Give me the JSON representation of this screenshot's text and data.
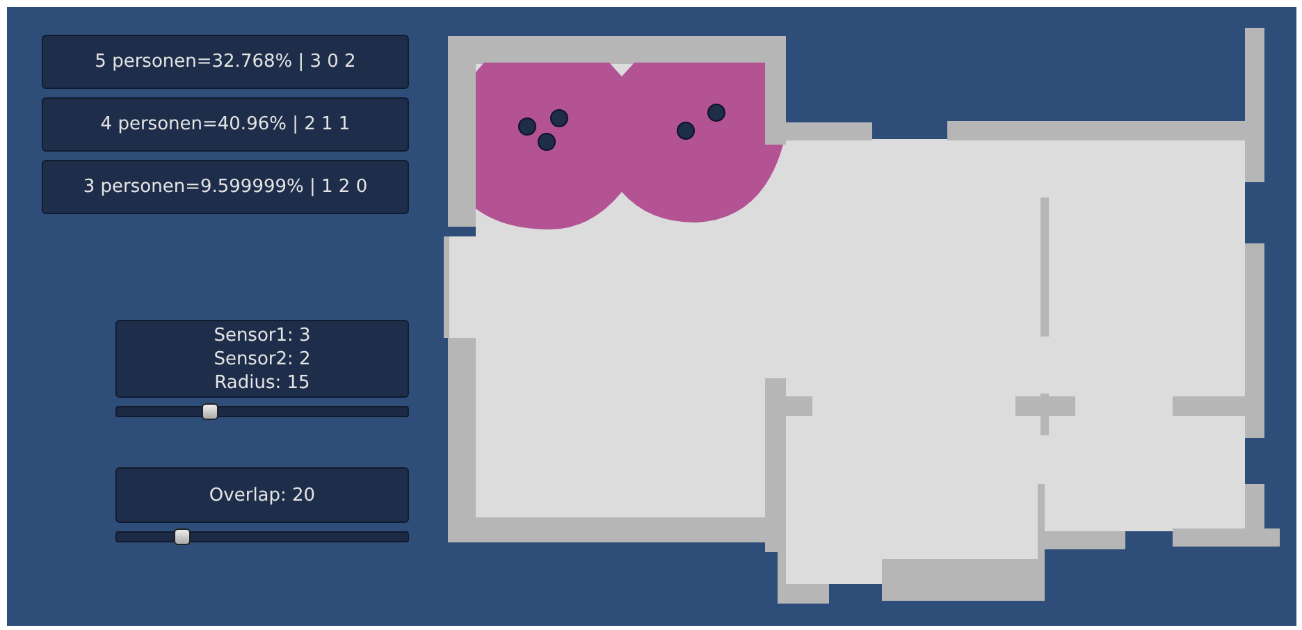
{
  "results": [
    {
      "text": "5 personen=32.768% | 3 0 2"
    },
    {
      "text": "4 personen=40.96% | 2 1 1"
    },
    {
      "text": "3 personen=9.599999% | 1 2 0"
    }
  ],
  "sensor_panel": {
    "lines": [
      "Sensor1: 3",
      "Sensor2: 2",
      "Radius: 15"
    ],
    "slider": {
      "level": 0.31
    }
  },
  "overlap_panel": {
    "label": "Overlap: 20",
    "slider": {
      "level": 0.21
    }
  }
}
